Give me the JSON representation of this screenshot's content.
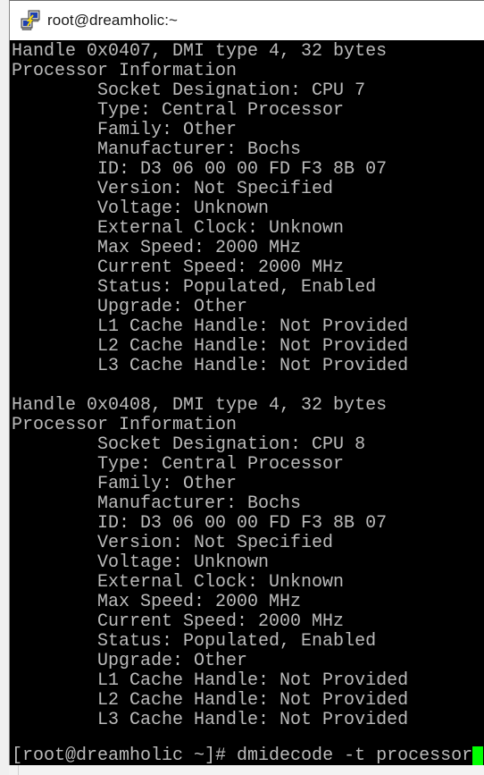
{
  "window": {
    "title": "root@dreamholic:~",
    "icon": "putty-terminal-icon"
  },
  "terminal": {
    "colors": {
      "background": "#000000",
      "foreground": "#bbbbbb",
      "cursor": "#00ff00"
    },
    "lines": [
      "Handle 0x0407, DMI type 4, 32 bytes",
      "Processor Information",
      "        Socket Designation: CPU 7",
      "        Type: Central Processor",
      "        Family: Other",
      "        Manufacturer: Bochs",
      "        ID: D3 06 00 00 FD F3 8B 07",
      "        Version: Not Specified",
      "        Voltage: Unknown",
      "        External Clock: Unknown",
      "        Max Speed: 2000 MHz",
      "        Current Speed: 2000 MHz",
      "        Status: Populated, Enabled",
      "        Upgrade: Other",
      "        L1 Cache Handle: Not Provided",
      "        L2 Cache Handle: Not Provided",
      "        L3 Cache Handle: Not Provided",
      "",
      "Handle 0x0408, DMI type 4, 32 bytes",
      "Processor Information",
      "        Socket Designation: CPU 8",
      "        Type: Central Processor",
      "        Family: Other",
      "        Manufacturer: Bochs",
      "        ID: D3 06 00 00 FD F3 8B 07",
      "        Version: Not Specified",
      "        Voltage: Unknown",
      "        External Clock: Unknown",
      "        Max Speed: 2000 MHz",
      "        Current Speed: 2000 MHz",
      "        Status: Populated, Enabled",
      "        Upgrade: Other",
      "        L1 Cache Handle: Not Provided",
      "        L2 Cache Handle: Not Provided",
      "        L3 Cache Handle: Not Provided"
    ],
    "prompt": "[root@dreamholic ~]# ",
    "command": "dmidecode -t processor"
  }
}
